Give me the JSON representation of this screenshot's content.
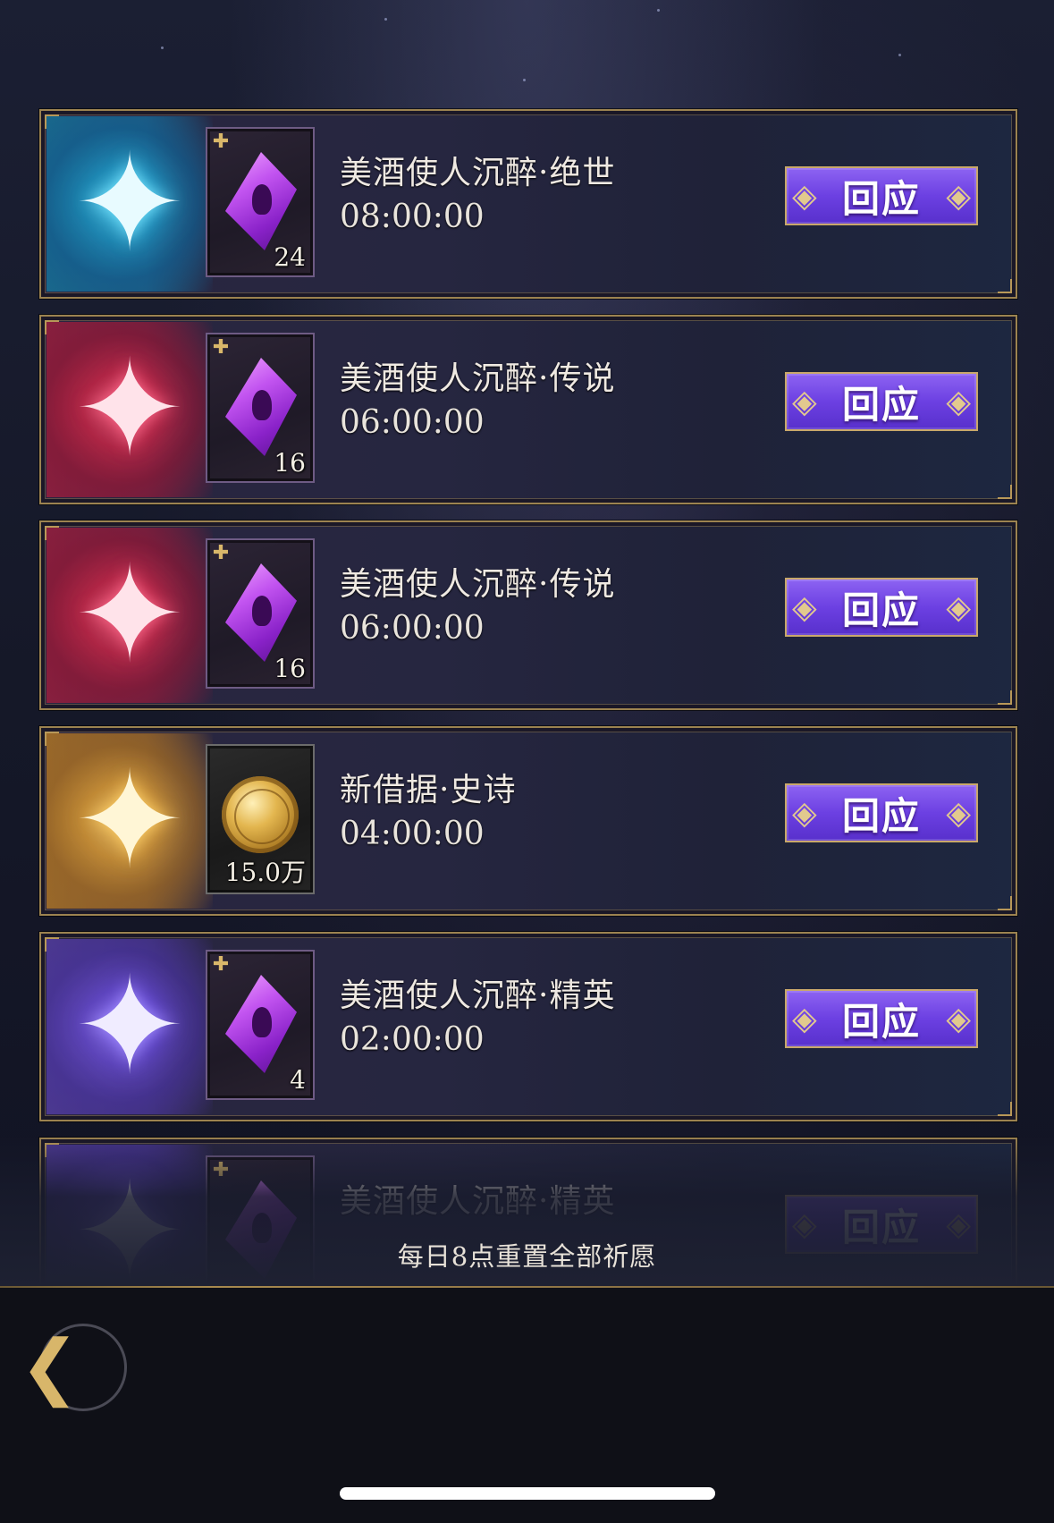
{
  "wishes": [
    {
      "rarity": "cyan",
      "title": "美酒使人沉醉·绝世",
      "timer": "08:00:00",
      "item": "gem",
      "qty": "24",
      "button": "回应"
    },
    {
      "rarity": "red",
      "title": "美酒使人沉醉·传说",
      "timer": "06:00:00",
      "item": "gem",
      "qty": "16",
      "button": "回应"
    },
    {
      "rarity": "red",
      "title": "美酒使人沉醉·传说",
      "timer": "06:00:00",
      "item": "gem",
      "qty": "16",
      "button": "回应"
    },
    {
      "rarity": "gold",
      "title": "新借据·史诗",
      "timer": "04:00:00",
      "item": "coin",
      "qty": "15.0万",
      "button": "回应"
    },
    {
      "rarity": "purple",
      "title": "美酒使人沉醉·精英",
      "timer": "02:00:00",
      "item": "gem",
      "qty": "4",
      "button": "回应"
    },
    {
      "rarity": "purple",
      "title": "美酒使人沉醉·精英",
      "timer": "",
      "item": "gem",
      "qty": "",
      "button": "回应"
    }
  ],
  "footer": {
    "reset_note": "每日8点重置全部祈愿"
  },
  "icons": {
    "rarity": "four-point-star-icon",
    "gem": "purple-gem-icon",
    "coin": "gold-coin-icon",
    "badge": "puzzle-piece-icon",
    "back": "back-arrow-icon"
  },
  "colors": {
    "button": "#6c40e2",
    "frame": "#9c8350",
    "cyan": "#27b9ea",
    "red": "#e0284f",
    "gold": "#e9a53a",
    "purple": "#6a48ff"
  }
}
